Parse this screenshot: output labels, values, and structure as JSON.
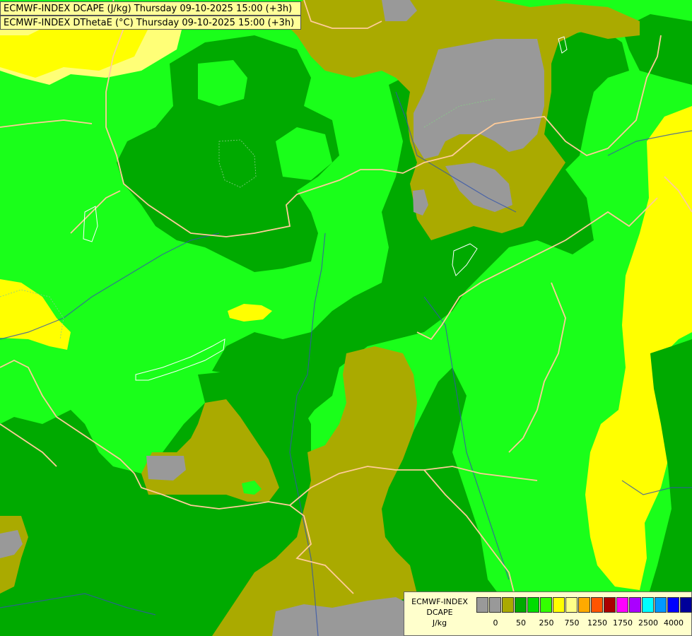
{
  "header": {
    "line1": "ECMWF-INDEX DCAPE (J/kg) Thursday 09-10-2025 15:00 (+3h)",
    "line2": "ECMWF-INDEX DThetaE (°C) Thursday 09-10-2025 15:00 (+3h)"
  },
  "legend": {
    "model": "ECMWF-INDEX",
    "variable": "DCAPE",
    "unit": "J/kg",
    "colors": [
      "#999999",
      "#999999",
      "#aaaa00",
      "#00aa00",
      "#00dd00",
      "#33ff00",
      "#ffff00",
      "#ffff88",
      "#ffaa00",
      "#ff5500",
      "#aa0000",
      "#ff00ff",
      "#aa00ff",
      "#00ffff",
      "#0099ff",
      "#0000ff",
      "#000099"
    ],
    "ticks": [
      {
        "label": "0",
        "index": 1
      },
      {
        "label": "50",
        "index": 3
      },
      {
        "label": "250",
        "index": 5
      },
      {
        "label": "750",
        "index": 7
      },
      {
        "label": "1250",
        "index": 9
      },
      {
        "label": "1750",
        "index": 11
      },
      {
        "label": "2500",
        "index": 13
      },
      {
        "label": "4000",
        "index": 15
      }
    ]
  },
  "map_colors": {
    "grey": "#999999",
    "olive": "#aaaa00",
    "dark_green": "#00aa00",
    "green": "#1aff1a",
    "yellow": "#ffff00",
    "light_yellow": "#ffff77",
    "border": "#ffcc99",
    "river": "#3355aa",
    "isoline": "#ffffff"
  }
}
